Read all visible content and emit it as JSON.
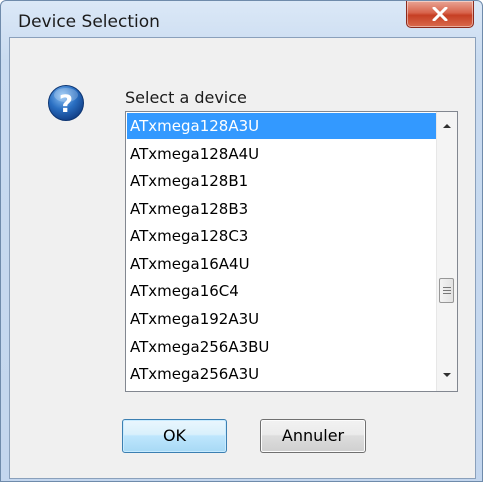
{
  "window": {
    "title": "Device Selection"
  },
  "dialog": {
    "icon": "question-icon",
    "prompt": "Select a device",
    "selected_index": 0,
    "devices": [
      "ATxmega128A3U",
      "ATxmega128A4U",
      "ATxmega128B1",
      "ATxmega128B3",
      "ATxmega128C3",
      "ATxmega16A4U",
      "ATxmega16C4",
      "ATxmega192A3U",
      "ATxmega256A3BU",
      "ATxmega256A3U"
    ],
    "ok_label": "OK",
    "cancel_label": "Annuler"
  },
  "colors": {
    "selection": "#3399ff",
    "close_button": "#c63f24",
    "title_bar": "#c9dbf0"
  }
}
